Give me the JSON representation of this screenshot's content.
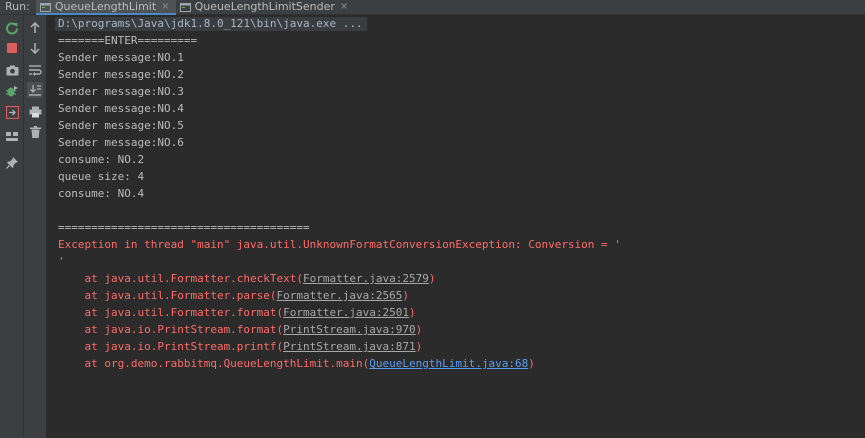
{
  "tabbar": {
    "run_label": "Run:",
    "tabs": [
      {
        "label": "QueueLengthLimit",
        "active": true
      },
      {
        "label": "QueueLengthLimitSender",
        "active": false
      }
    ],
    "close_glyph": "×"
  },
  "console": {
    "command": "D:\\programs\\Java\\jdk1.8.0_121\\bin\\java.exe ...",
    "output": [
      "=======ENTER=========",
      "Sender message:NO.1",
      "Sender message:NO.2",
      "Sender message:NO.3",
      "Sender message:NO.4",
      "Sender message:NO.5",
      "Sender message:NO.6",
      "consume: NO.2",
      "queue size: 4",
      "consume: NO.4",
      "",
      "======================================"
    ],
    "exception_line1": "Exception in thread \"main\" java.util.UnknownFormatConversionException: Conversion = '",
    "exception_line2": "'",
    "stack": [
      {
        "prefix": "    at java.util.Formatter.checkText(",
        "link": "Formatter.java:2579",
        "suffix": ")",
        "highlight": false
      },
      {
        "prefix": "    at java.util.Formatter.parse(",
        "link": "Formatter.java:2565",
        "suffix": ")",
        "highlight": false
      },
      {
        "prefix": "    at java.util.Formatter.format(",
        "link": "Formatter.java:2501",
        "suffix": ")",
        "highlight": false
      },
      {
        "prefix": "    at java.io.PrintStream.format(",
        "link": "PrintStream.java:970",
        "suffix": ")",
        "highlight": false
      },
      {
        "prefix": "    at java.io.PrintStream.printf(",
        "link": "PrintStream.java:871",
        "suffix": ")",
        "highlight": false
      },
      {
        "prefix": "    at org.demo.rabbitmq.QueueLengthLimit.main(",
        "link": "QueueLengthLimit.java:68",
        "suffix": ")",
        "highlight": true
      }
    ]
  },
  "colors": {
    "background": "#2b2b2b",
    "panel": "#3c3f41",
    "text": "#bbbbbb",
    "error": "#ff6b68",
    "link": "#589df6",
    "rerun_green": "#59a869",
    "stop_red": "#db5c5c"
  },
  "icons": {
    "strip1": [
      "rerun-icon",
      "stop-icon",
      "camera-icon",
      "debug-bug-icon",
      "exit-icon",
      "layout-icon",
      "pin-icon"
    ],
    "strip2": [
      "arrow-up-icon",
      "arrow-down-icon",
      "soft-wrap-icon",
      "scroll-to-end-icon",
      "print-icon",
      "trash-icon"
    ]
  }
}
